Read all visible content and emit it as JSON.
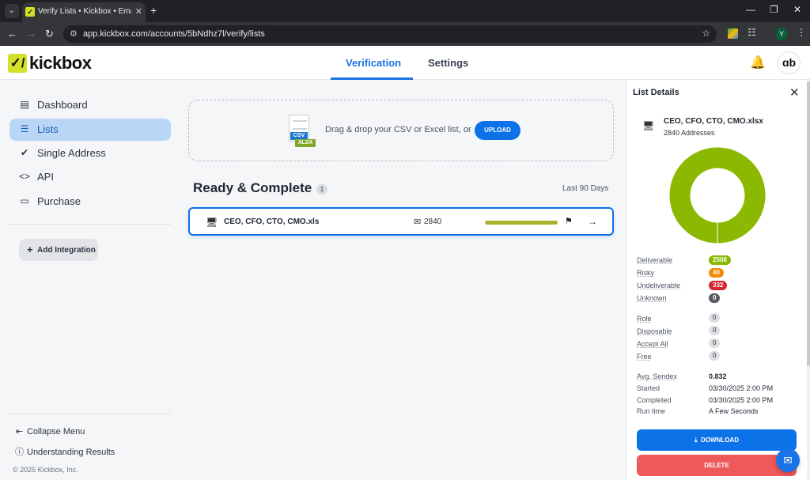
{
  "browser": {
    "tab_title": "Verify Lists • Kickbox • Email Ve",
    "url": "app.kickbox.com/accounts/5bNdhz7l/verify/lists",
    "profile_initial": "Y"
  },
  "header": {
    "logo_mark": "✓/",
    "logo_text": "kickbox",
    "tabs": [
      {
        "label": "Verification",
        "active": true
      },
      {
        "label": "Settings",
        "active": false
      }
    ],
    "user_initials": "ɑb"
  },
  "sidebar": {
    "items": [
      {
        "label": "Dashboard",
        "icon": "bar-chart-icon",
        "active": false
      },
      {
        "label": "Lists",
        "icon": "list-icon",
        "active": true
      },
      {
        "label": "Single Address",
        "icon": "check-circle-icon",
        "active": false
      },
      {
        "label": "API",
        "icon": "code-icon",
        "active": false
      },
      {
        "label": "Purchase",
        "icon": "credit-card-icon",
        "active": false
      }
    ],
    "add_integration": "Add Integration",
    "collapse_menu": "Collapse Menu",
    "understanding_results": "Understanding Results",
    "copyright": "© 2025 Kickbox, Inc."
  },
  "dropzone": {
    "csv_label": "CSV",
    "xlsx_label": "XLSX",
    "text": "Drag & drop your CSV or Excel list, or",
    "upload_label": "UPLOAD"
  },
  "lists_section": {
    "title": "Ready & Complete",
    "count": "1",
    "range": "Last 90 Days",
    "rows": [
      {
        "name": "CEO, CFO, CTO, CMO.xls",
        "count": "2840",
        "progress": 1.0
      }
    ]
  },
  "details": {
    "title": "List Details",
    "file_name": "CEO, CFO, CTO, CMO.xlsx",
    "addresses": "2840 Addresses",
    "donut": {
      "deliverable": 2508,
      "risky": 40,
      "undeliverable": 332,
      "unknown": 0
    },
    "colors": {
      "deliverable": "#8bb800",
      "risky": "#f08a00",
      "undeliverable": "#d7262b",
      "unknown": "#585c62"
    },
    "results": [
      {
        "label": "Deliverable",
        "value": "2508",
        "style": "pill-green"
      },
      {
        "label": "Risky",
        "value": "40",
        "style": "pill-orange"
      },
      {
        "label": "Undeliverable",
        "value": "332",
        "style": "pill-red"
      },
      {
        "label": "Unknown",
        "value": "0",
        "style": "pill-dark"
      }
    ],
    "flags": [
      {
        "label": "Role",
        "value": "0"
      },
      {
        "label": "Disposable",
        "value": "0"
      },
      {
        "label": "Accept All",
        "value": "0"
      },
      {
        "label": "Free",
        "value": "0"
      }
    ],
    "meta": [
      {
        "label": "Avg. Sendex",
        "value": "0.832"
      },
      {
        "label": "Started",
        "value": "03/30/2025 2:00 PM"
      },
      {
        "label": "Completed",
        "value": "03/30/2025 2:00 PM"
      },
      {
        "label": "Run time",
        "value": "A Few Seconds"
      }
    ],
    "download_label": "DOWNLOAD",
    "delete_label": "DELETE"
  }
}
